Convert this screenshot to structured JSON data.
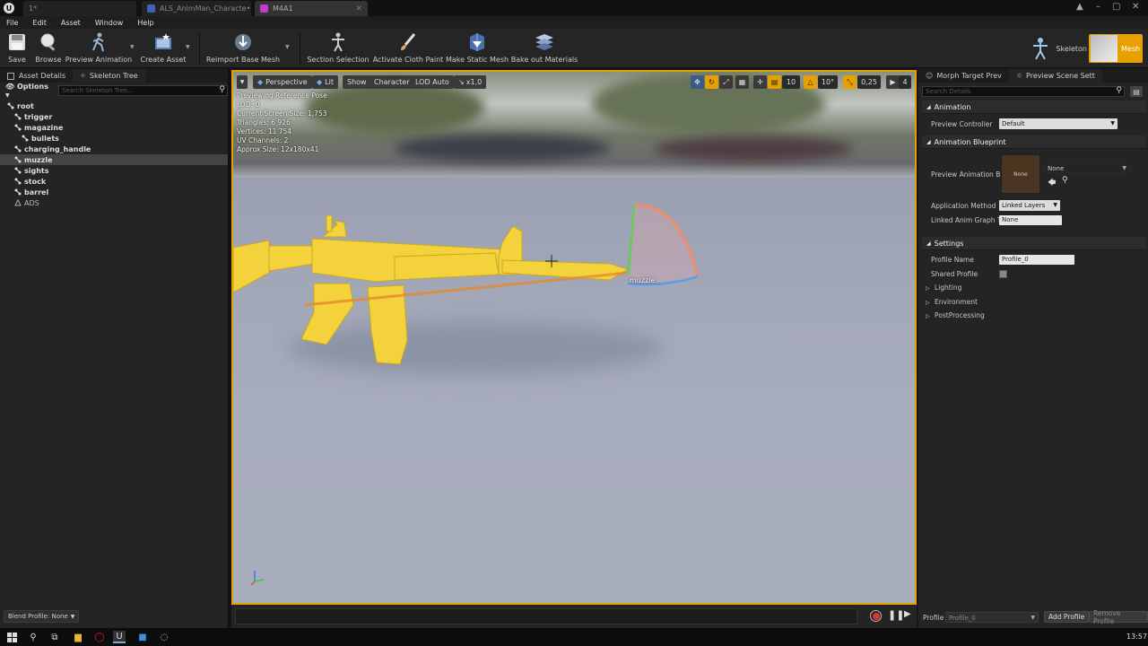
{
  "window": {
    "tabs": [
      {
        "label": "1*"
      },
      {
        "label": "ALS_AnimMan_Characte•"
      },
      {
        "label": "M4A1"
      }
    ]
  },
  "menu": [
    "File",
    "Edit",
    "Asset",
    "Window",
    "Help"
  ],
  "toolbar": {
    "save": "Save",
    "browse": "Browse",
    "preview_animation": "Preview Animation",
    "create_asset": "Create Asset",
    "reimport": "Reimport Base Mesh",
    "section_selection": "Section Selection",
    "activate_cloth": "Activate Cloth Paint",
    "make_static_mesh": "Make Static Mesh",
    "bake_materials": "Bake out Materials",
    "mode_skeleton": "Skeleton",
    "mode_mesh": "Mesh"
  },
  "left_panel": {
    "tab_asset_details": "Asset Details",
    "tab_skeleton_tree": "Skeleton Tree",
    "options": "Options",
    "search_placeholder": "Search Skeleton Tree...",
    "tree": [
      {
        "label": "root",
        "depth": 0,
        "type": "bone",
        "selected": false
      },
      {
        "label": "trigger",
        "depth": 1,
        "type": "bone",
        "selected": false
      },
      {
        "label": "magazine",
        "depth": 1,
        "type": "bone",
        "selected": false
      },
      {
        "label": "bullets",
        "depth": 2,
        "type": "bone",
        "selected": false
      },
      {
        "label": "charging_handle",
        "depth": 1,
        "type": "bone",
        "selected": false
      },
      {
        "label": "muzzle",
        "depth": 1,
        "type": "bone",
        "selected": true
      },
      {
        "label": "sights",
        "depth": 1,
        "type": "bone",
        "selected": false
      },
      {
        "label": "stock",
        "depth": 1,
        "type": "bone",
        "selected": false
      },
      {
        "label": "barrel",
        "depth": 1,
        "type": "bone",
        "selected": false
      },
      {
        "label": "ADS",
        "depth": 1,
        "type": "socket",
        "selected": false
      }
    ],
    "blend_profile": "Blend Profile: None"
  },
  "viewport": {
    "perspective": "Perspective",
    "lit": "Lit",
    "show": "Show",
    "character": "Character",
    "lod": "LOD Auto",
    "speed": "x1,0",
    "info": [
      "Previewing Reference Pose",
      "LOD: 0",
      "Current Screen Size: 1,753",
      "Triangles: 6 926",
      "Vertices: 11 754",
      "UV Channels: 2",
      "Approx Size: 12x180x41"
    ],
    "grid_snap": "10",
    "rot_snap": "10°",
    "scale_snap": "0,25",
    "camera_speed": "4",
    "bone_label": "muzzle"
  },
  "right_panel": {
    "tab_morph": "Morph Target Prev",
    "tab_scene": "Preview Scene Sett",
    "search_placeholder": "Search Details",
    "animation_section": "Animation",
    "preview_controller_label": "Preview Controller",
    "preview_controller_value": "Default",
    "anim_bp_section": "Animation Blueprint",
    "preview_anim_bp_label": "Preview Animation Bl",
    "thumb_label": "None",
    "anim_bp_value": "None",
    "app_method_label": "Application Method",
    "app_method_value": "Linked Layers",
    "linked_tag_label": "Linked Anim Graph Ta",
    "linked_tag_value": "None",
    "settings_section": "Settings",
    "profile_name_label": "Profile Name",
    "profile_name_value": "Profile_0",
    "shared_profile_label": "Shared Profile",
    "lighting": "Lighting",
    "environment": "Environment",
    "postprocessing": "PostProcessing",
    "profile_label": "Profile",
    "profile_combo": "Profile_0",
    "add_profile": "Add Profile",
    "remove_profile": "Remove Profile"
  },
  "taskbar": {
    "clock": "13:57"
  },
  "colors": {
    "accent": "#e8a000",
    "rifle": "#f3d23c",
    "selection": "#444444"
  }
}
